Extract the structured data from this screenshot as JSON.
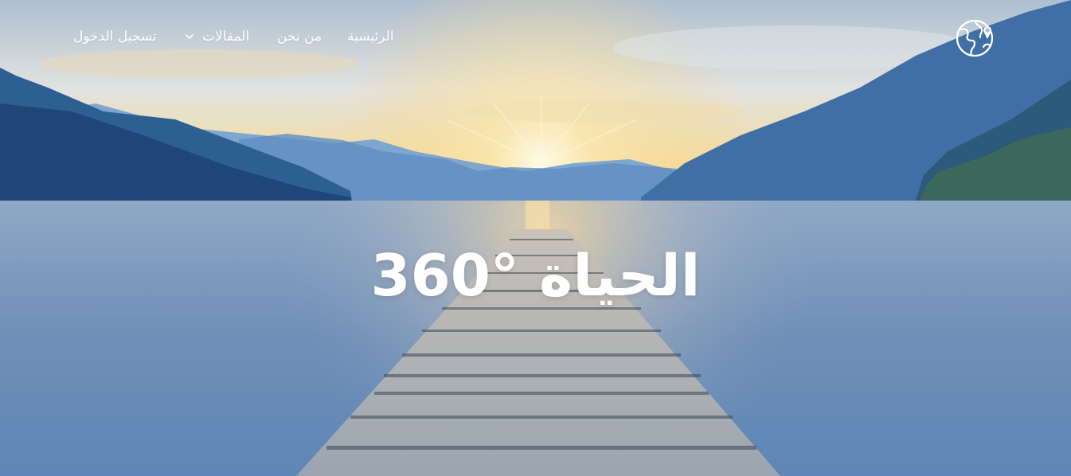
{
  "nav": {
    "home": "الرئيسية",
    "about": "من نحن",
    "articles": "المقالات",
    "login": "تسجيل الدخول"
  },
  "hero": {
    "title": "الحياة °360"
  },
  "icons": {
    "logo": "globe-person-icon",
    "dropdown": "chevron-down-icon"
  },
  "colors": {
    "nav_text": "#ffffff",
    "sky_top": "#b9c8d6",
    "sunset": "#f6d28a",
    "water": "#6f93bd"
  }
}
